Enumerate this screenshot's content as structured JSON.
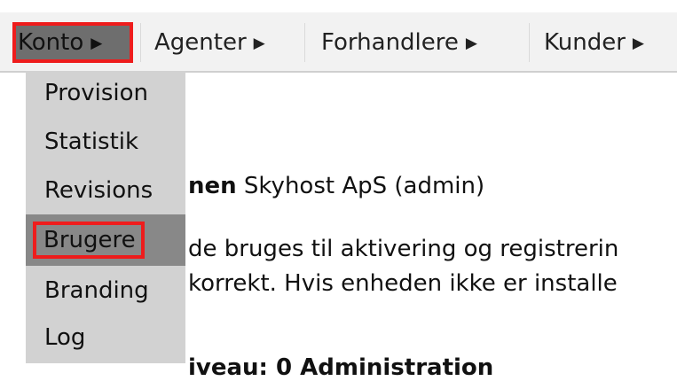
{
  "nav": {
    "items": [
      {
        "label": "Konto"
      },
      {
        "label": "Agenter"
      },
      {
        "label": "Forhandlere"
      },
      {
        "label": "Kunder"
      }
    ],
    "arrow_glyph": "▶"
  },
  "dropdown": {
    "items": [
      {
        "label": "Provision"
      },
      {
        "label": "Statistik"
      },
      {
        "label": "Revisions"
      },
      {
        "label": "Brugere"
      },
      {
        "label": "Branding"
      },
      {
        "label": "Log"
      }
    ]
  },
  "content": {
    "line1_bold": "nen",
    "line1_rest": " Skyhost ApS (admin)",
    "line2": "de bruges til aktivering og registrerin",
    "line3": "korrekt. Hvis enheden ikke er installe",
    "line4": "iveau:     0   Administration"
  },
  "colors": {
    "highlight_border": "#ee1c1c",
    "active_bg": "#6e6e6e",
    "menu_bg": "#d2d2d2",
    "hover_bg": "#888888"
  }
}
